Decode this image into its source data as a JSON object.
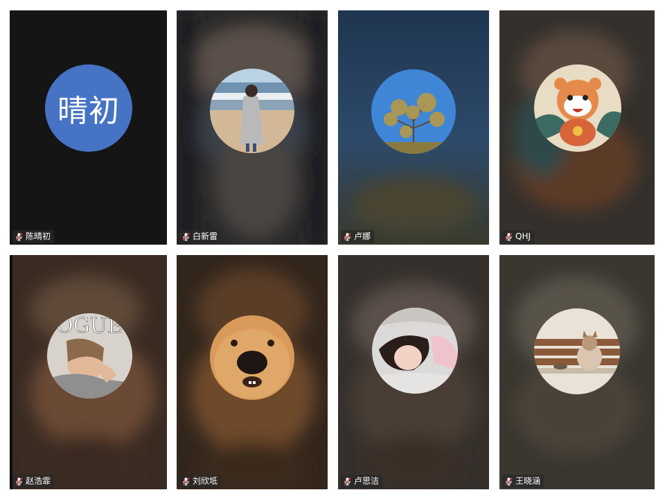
{
  "participants": [
    {
      "name": "陈晴初",
      "initials": "晴初",
      "avatar_type": "initials",
      "avatar_color": "#4673c4",
      "muted": true,
      "mic_icon": "mic-muted-icon"
    },
    {
      "name": "白新雷",
      "avatar_type": "photo",
      "avatar_desc": "woman-on-beach",
      "muted": true,
      "mic_icon": "mic-muted-icon"
    },
    {
      "name": "卢娜",
      "avatar_type": "photo",
      "avatar_desc": "tree-blue-sky",
      "muted": true,
      "mic_icon": "mic-muted-icon"
    },
    {
      "name": "QHJ",
      "avatar_type": "photo",
      "avatar_desc": "cartoon-tiger",
      "muted": true,
      "mic_icon": "mic-muted-icon"
    },
    {
      "name": "赵浩霏",
      "avatar_type": "photo",
      "avatar_desc": "magazine-cover-portrait",
      "muted": true,
      "mic_icon": "mic-muted-icon"
    },
    {
      "name": "刘欣坻",
      "avatar_type": "photo",
      "avatar_desc": "golden-retriever-closeup",
      "muted": true,
      "mic_icon": "mic-muted-icon"
    },
    {
      "name": "卢思洁",
      "avatar_type": "photo",
      "avatar_desc": "girl-lying-on-pillow",
      "muted": true,
      "mic_icon": "mic-muted-icon"
    },
    {
      "name": "王晓涵",
      "avatar_type": "photo",
      "avatar_desc": "cat-on-bench",
      "muted": true,
      "mic_icon": "mic-muted-icon"
    }
  ],
  "colors": {
    "initials_bg": "#4673c4",
    "nametag_bg": "#282828",
    "tile_dark": "#151515"
  }
}
